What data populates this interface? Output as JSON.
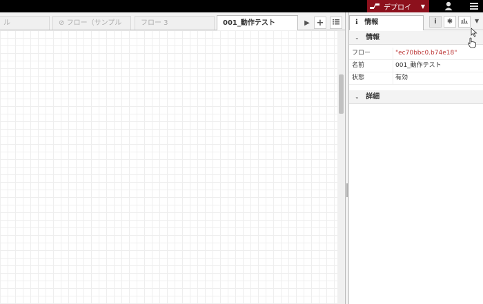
{
  "header": {
    "deploy_label": "デプロイ",
    "colors": {
      "background": "#000000",
      "deploy": "#8c101c"
    }
  },
  "tabs": [
    {
      "label": "ル",
      "active": false
    },
    {
      "label": "フロー（サンプル",
      "disabled_icon": "ban-icon",
      "active": false
    },
    {
      "label": "フロー 3",
      "active": false
    },
    {
      "label": "001_動作テスト",
      "active": true
    }
  ],
  "sidebar": {
    "tab_label": "情報",
    "info_section": {
      "title": "情報"
    },
    "properties": [
      {
        "key": "フロー",
        "value": "\"ec70bbc0.b74e18\""
      },
      {
        "key": "名前",
        "value": "001_動作テスト"
      },
      {
        "key": "状態",
        "value": "有効"
      }
    ],
    "details_section": {
      "title": "詳細"
    }
  }
}
